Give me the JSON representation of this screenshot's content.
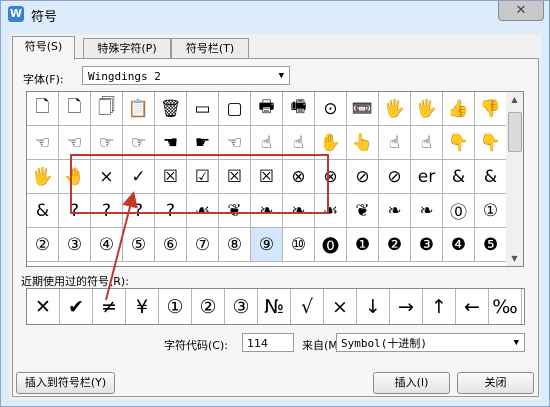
{
  "title": "符号",
  "tabs": [
    {
      "label": "符号(S)"
    },
    {
      "label": "特殊字符(P)"
    },
    {
      "label": "符号栏(T)"
    }
  ],
  "font_label": "字体(F):",
  "font_value": "Wingdings 2",
  "symbol_grid": [
    [
      "🗋",
      "🗋",
      "🗍",
      "📋",
      "🗑",
      "▭",
      "▢",
      "🖶",
      "🖷",
      "⊙",
      "📼",
      "🖐",
      "🖐",
      "👍",
      "👎"
    ],
    [
      "☜",
      "☜",
      "☞",
      "☞",
      "☚",
      "☛",
      "☜",
      "☝",
      "☝",
      "✋",
      "👆",
      "☝",
      "☝",
      "👇",
      "👇"
    ],
    [
      "🖐",
      "🤚",
      "×",
      "✓",
      "☒",
      "☑",
      "☒",
      "☒",
      "⊗",
      "⊗",
      "⊘",
      "⊘",
      "er",
      "&",
      "&"
    ],
    [
      "&",
      "?",
      "?",
      "?",
      "?",
      "☙",
      "❦",
      "❧",
      "❧",
      "☙",
      "❦",
      "❧",
      "❧",
      "⓪",
      "①"
    ],
    [
      "②",
      "③",
      "④",
      "⑤",
      "⑥",
      "⑦",
      "⑧",
      "⑨",
      "⑩",
      "⓿",
      "❶",
      "❷",
      "❸",
      "❹",
      "❺"
    ]
  ],
  "selected_symbol": "⑨",
  "recent_label": "近期使用过的符号(R):",
  "recent_symbols": [
    "✕",
    "✔",
    "≠",
    "¥",
    "①",
    "②",
    "③",
    "№",
    "√",
    "×",
    "↓",
    "→",
    "↑",
    "←",
    "‰"
  ],
  "code_label": "字符代码(C):",
  "code_value": "114",
  "from_label": "来自(M)",
  "from_value": "Symbol(十进制)",
  "buttons": {
    "insert_to_bar": "插入到符号栏(Y)",
    "insert": "插入(I)",
    "close": "关闭"
  },
  "annotation_color": "#c0392b"
}
